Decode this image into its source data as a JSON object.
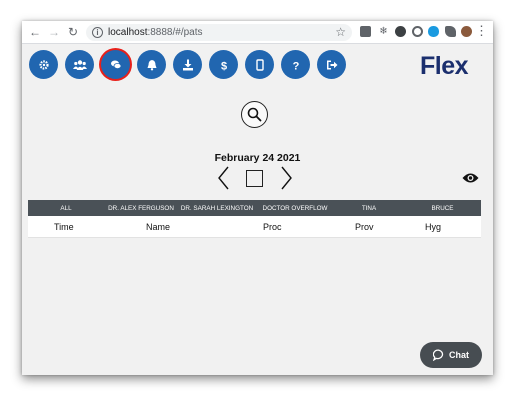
{
  "browser": {
    "url_host": "localhost",
    "url_rest": ":8888/#/pats"
  },
  "toolbar": {
    "buttons": [
      {
        "icon": "gear-icon"
      },
      {
        "icon": "users-icon"
      },
      {
        "icon": "chat-bubbles-icon",
        "active": true
      },
      {
        "icon": "bell-icon"
      },
      {
        "icon": "download-icon"
      },
      {
        "icon": "dollar-icon"
      },
      {
        "icon": "tablet-icon"
      },
      {
        "icon": "question-icon"
      },
      {
        "icon": "sign-out-icon"
      }
    ],
    "logo": "Flex"
  },
  "schedule": {
    "date": "February 24 2021",
    "provider_columns": [
      "ALL",
      "DR. ALEX FERGUSON",
      "DR. SARAH LEXINGTON",
      "DOCTOR OVERFLOW",
      "TINA",
      "BRUCE"
    ],
    "field_headers": [
      "Time",
      "Name",
      "Proc",
      "Prov",
      "Hyg"
    ]
  },
  "chat": {
    "label": "Chat"
  },
  "colors": {
    "primary": "#2166b0",
    "active_ring": "#e8201a",
    "header_bar": "#4a5157",
    "chat_bg": "#474d52",
    "logo": "#1b2f6e",
    "logo_accent": "#3aa5e0"
  }
}
